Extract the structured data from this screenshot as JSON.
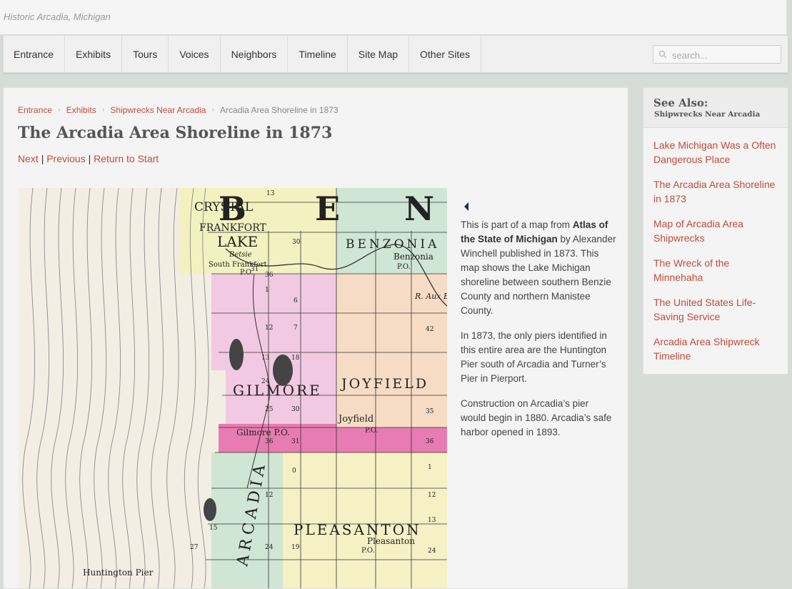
{
  "site": {
    "title": "Historic Arcadia, Michigan"
  },
  "nav": {
    "items": [
      "Entrance",
      "Exhibits",
      "Tours",
      "Voices",
      "Neighbors",
      "Timeline",
      "Site Map",
      "Other Sites"
    ],
    "search_placeholder": "search..."
  },
  "breadcrumb": {
    "items": [
      "Entrance",
      "Exhibits",
      "Shipwrecks Near Arcadia"
    ],
    "current": "Arcadia Area Shoreline in 1873"
  },
  "page": {
    "title": "The Arcadia Area Shoreline in 1873",
    "pager": {
      "next": "Next",
      "sep": "|",
      "previous": "Previous",
      "return": "Return to Start"
    }
  },
  "map": {
    "labels": {
      "top_b": "B",
      "top_e": "E",
      "top_n": "N",
      "crystal": "CRYSTAL",
      "frankfort": "FRANKFORT",
      "lake": "LAKE",
      "betsie": "Betsie",
      "south_frankfort": "South Frankfort",
      "po1": "P.O.",
      "benzonia_t": "BENZONIA",
      "benzonia": "Benzonia",
      "po2": "P.O.",
      "river": "R. Aux Becs",
      "gilmore": "GILMORE",
      "joyfield_t": "JOYFIELD",
      "joyfield": "Joyfield",
      "po3": "P.O.",
      "gilmore_po": "Gilmore P.O.",
      "arcadia": "ARCADIA",
      "pleasanton_t": "PLEASANTON",
      "pleasanton": "Pleasanton",
      "po4": "P.O.",
      "huntington": "Huntington Pier"
    },
    "numbers": [
      "13",
      "30",
      "31",
      "36",
      "1",
      "6",
      "12",
      "7",
      "42",
      "13",
      "18",
      "24",
      "25",
      "30",
      "35",
      "36",
      "31",
      "36",
      "0",
      "1",
      "12",
      "12",
      "13",
      "15",
      "24",
      "19",
      "27",
      "24"
    ]
  },
  "description": {
    "p1_a": "This is part of a map from ",
    "p1_b": "Atlas of the State of Michigan",
    "p1_c": " by Alexander Winchell published in 1873. This map shows the Lake Michigan shoreline between southern Benzie County and northern Manistee County.",
    "p2": "In 1873, the only piers identified in this entire area are the Huntington Pier south of Arcadia and Turner’s Pier in Pierport.",
    "p3": "Construction on Arcadia’s pier would begin in 1880. Arcadia’s safe harbor opened in 1893."
  },
  "sidebar": {
    "heading": "See Also:",
    "subheading": "Shipwrecks Near Arcadia",
    "links": [
      "Lake Michigan Was a Often Dangerous Place",
      "The Arcadia Area Shoreline in 1873",
      "Map of Arcadia Area Shipwrecks",
      "The Wreck of the Minnehaha",
      "The United States Life-Saving Service",
      "Arcadia Area Shipwreck Timeline"
    ]
  },
  "colors": {
    "link": "#c24b3a",
    "background": "#d8dcd9",
    "card": "#f4f4f4"
  }
}
